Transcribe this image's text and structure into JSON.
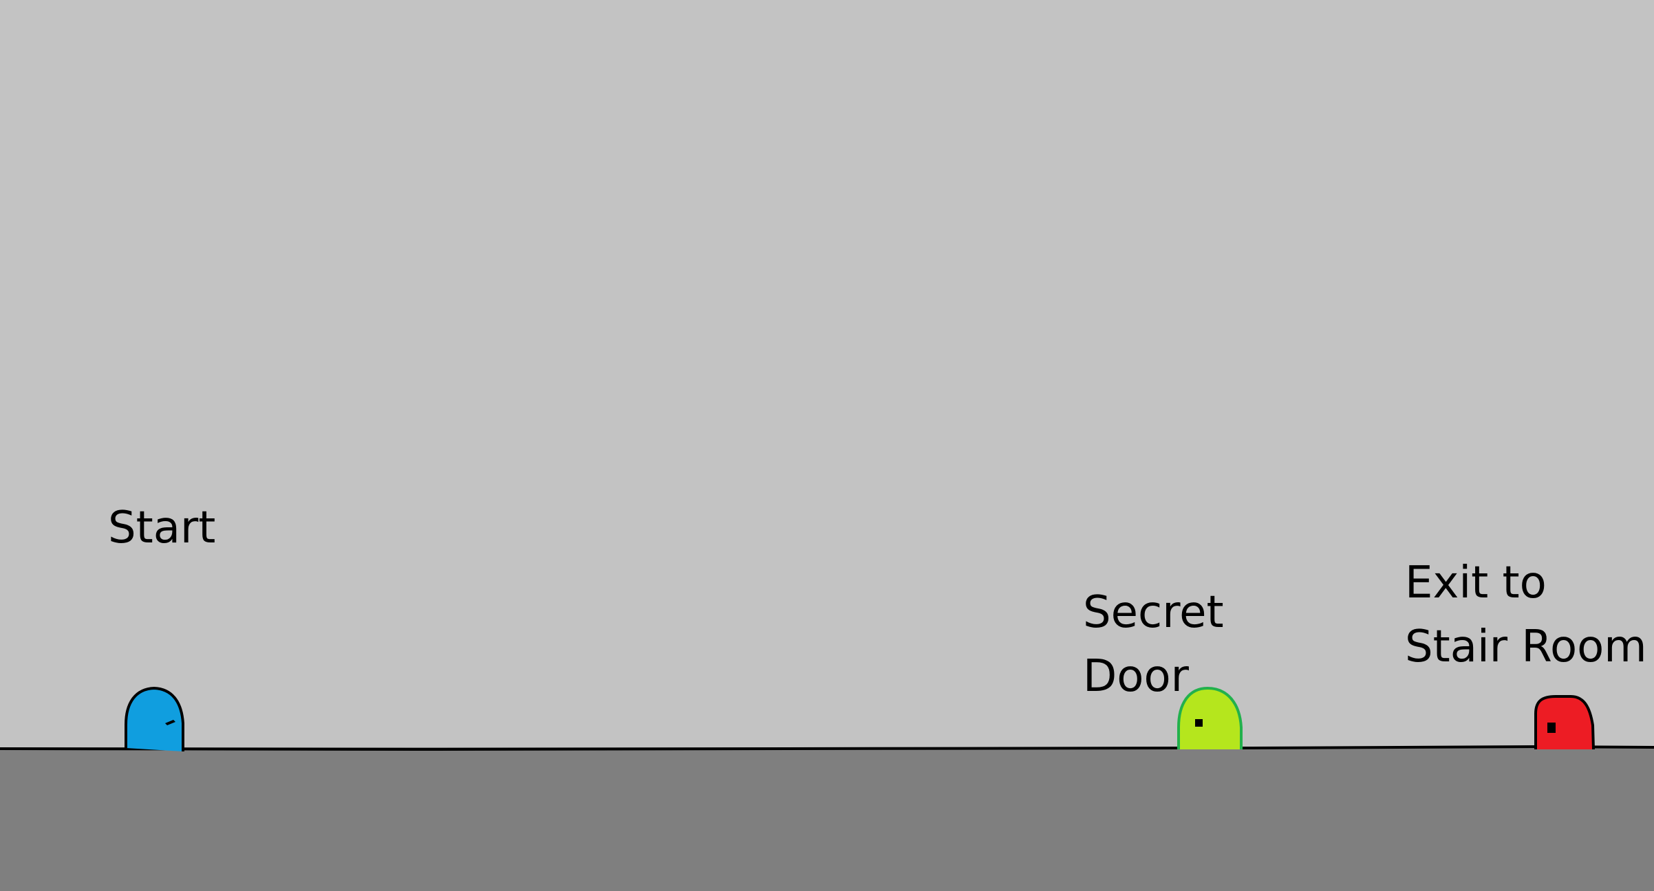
{
  "labels": {
    "start": [
      "Start"
    ],
    "secret_door": [
      "Secret",
      "Door"
    ],
    "exit": [
      "Exit to",
      "Stair Room"
    ]
  },
  "doors": {
    "start": {
      "color": "#109edf",
      "outline": "#000000",
      "icon": "blue-door-icon"
    },
    "secret": {
      "color": "#b5e61d",
      "outline": "#22b14c",
      "icon": "green-door-icon"
    },
    "exit": {
      "color": "#ed1c24",
      "outline": "#000000",
      "icon": "red-door-icon"
    }
  },
  "colors": {
    "sky": "#c3c3c3",
    "ground": "#7f7f7f",
    "ground_line": "#000000"
  }
}
